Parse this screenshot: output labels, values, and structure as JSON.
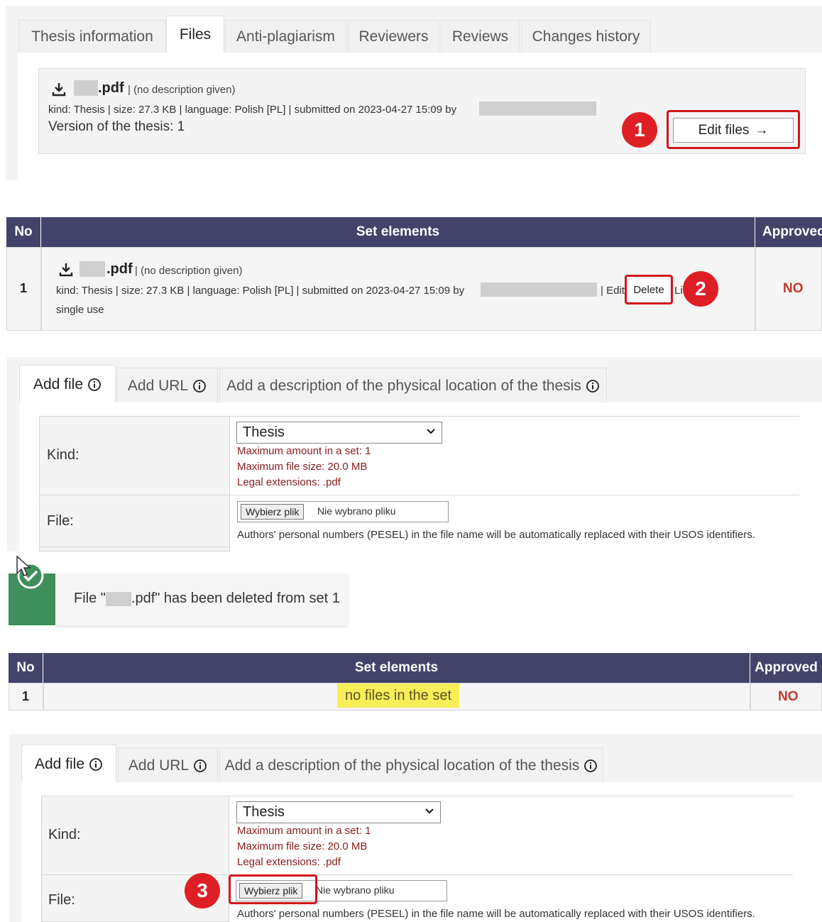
{
  "tabs": {
    "items": [
      "Thesis information",
      "Files",
      "Anti-plagiarism",
      "Reviewers",
      "Reviews",
      "Changes history"
    ],
    "active": "Files"
  },
  "file_summary": {
    "file_ext": ".pdf",
    "description": "| (no description given)",
    "meta": "kind: Thesis | size: 27.3 KB | language: Polish [PL] | submitted on 2023-04-27 15:09 by",
    "version": "Version of the thesis: 1",
    "edit_button": "Edit files",
    "edit_arrow": "→"
  },
  "annotations": [
    "1",
    "2",
    "3"
  ],
  "set_table_1": {
    "headers": {
      "no": "No",
      "elements": "Set elements",
      "approved": "Approved"
    },
    "row": {
      "no": "1",
      "file_ext": ".pdf",
      "description": "| (no description given)",
      "meta": "kind: Thesis | size: 27.3 KB | language: Polish [PL] | submitted on 2023-04-27 15:09 by",
      "edit_action": "| Edit",
      "delete_action": "Delete",
      "trailing_action": "Li",
      "usage": "single use",
      "approved": "NO"
    }
  },
  "add_form_1": {
    "tabs": [
      "Add file",
      "Add URL",
      "Add a description of the physical location of the thesis"
    ],
    "kind_label": "Kind:",
    "kind_value": "Thesis",
    "limits": [
      "Maximum amount in a set: 1",
      "Maximum file size: 20.0 MB",
      "Legal extensions: .pdf"
    ],
    "file_label": "File:",
    "choose_button": "Wybierz plik",
    "no_file": "Nie wybrano pliku",
    "hint": "Authors' personal numbers (PESEL) in the file name will be automatically replaced with their USOS identifiers."
  },
  "notification": {
    "prefix": "File \"",
    "suffix": ".pdf\" has been deleted from set 1"
  },
  "set_table_2": {
    "headers": {
      "no": "No",
      "elements": "Set elements",
      "approved": "Approved"
    },
    "row": {
      "no": "1",
      "elements": "no files in the set",
      "approved": "NO"
    }
  },
  "add_form_2": {
    "tabs": [
      "Add file",
      "Add URL",
      "Add a description of the physical location of the thesis"
    ],
    "kind_label": "Kind:",
    "kind_value": "Thesis",
    "limits": [
      "Maximum amount in a set: 1",
      "Maximum file size: 20.0 MB",
      "Legal extensions: .pdf"
    ],
    "file_label": "File:",
    "choose_button": "Wybierz plik",
    "no_file": "Nie wybrano pliku",
    "hint": "Authors' personal numbers (PESEL) in the file name will be automatically replaced with their USOS identifiers."
  },
  "colors": {
    "header_bg": "#43436a",
    "annotation_red": "#df1f26",
    "approved_no": "#c0392b",
    "limit_text": "#8b1a1a",
    "notification_green": "#3e8f5a",
    "highlight": "#f7ee58"
  },
  "icons": [
    "download-icon",
    "info-icon",
    "arrow-right-icon",
    "chevron-down-icon",
    "check-circle-icon",
    "mouse-cursor-icon"
  ]
}
